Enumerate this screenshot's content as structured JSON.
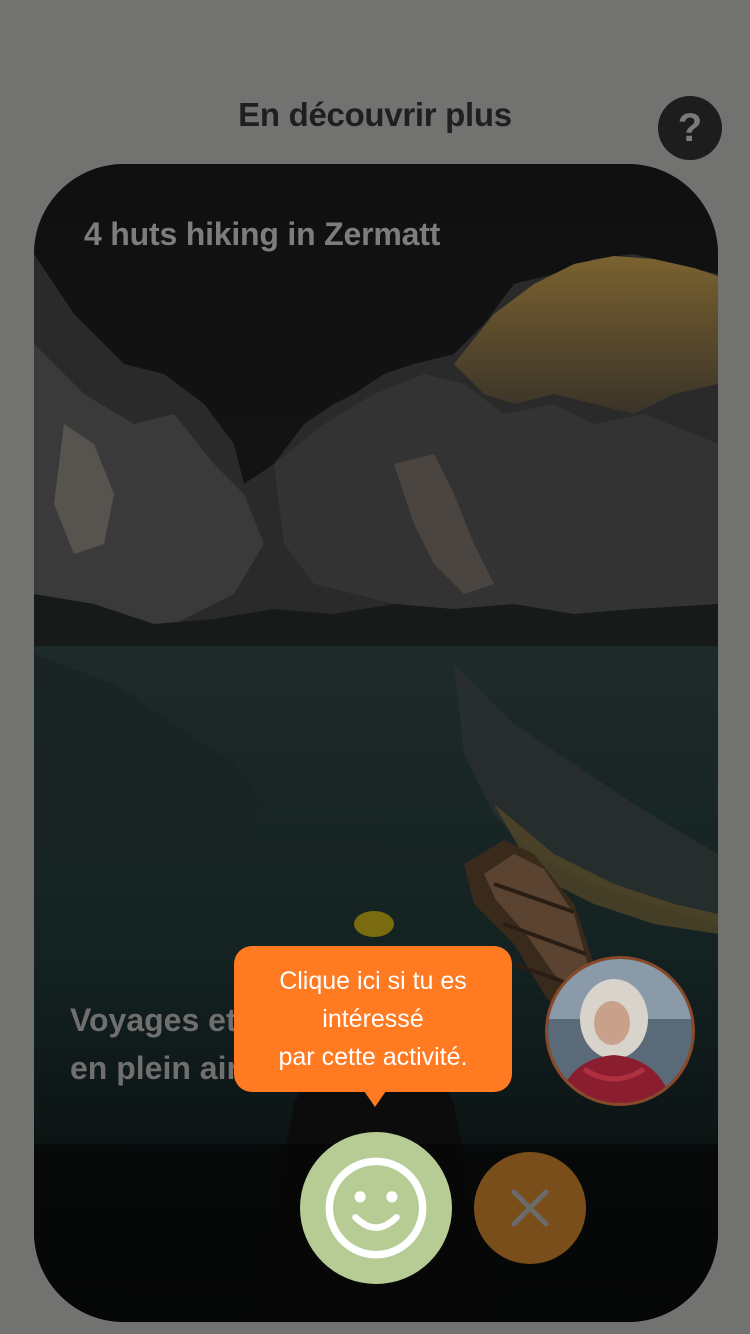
{
  "header": {
    "title": "En découvrir plus",
    "help_icon": "question-mark-icon",
    "help_glyph": "?"
  },
  "card": {
    "title": "4 huts hiking in Zermatt",
    "tagline_line1": "Voyages et activités",
    "tagline_line2": "en plein air",
    "image": "mountain-lake-with-boat"
  },
  "tooltip": {
    "line1": "Clique ici si tu es",
    "line2": "intéressé",
    "line3": "par cette activité."
  },
  "actions": {
    "like_icon": "smiley-icon",
    "dismiss_icon": "close-icon"
  },
  "colors": {
    "accent_orange": "#ff7a21",
    "like_green": "#b7cc95",
    "dismiss_brown": "#7a4e1a",
    "overlay_gray": "#727270"
  }
}
